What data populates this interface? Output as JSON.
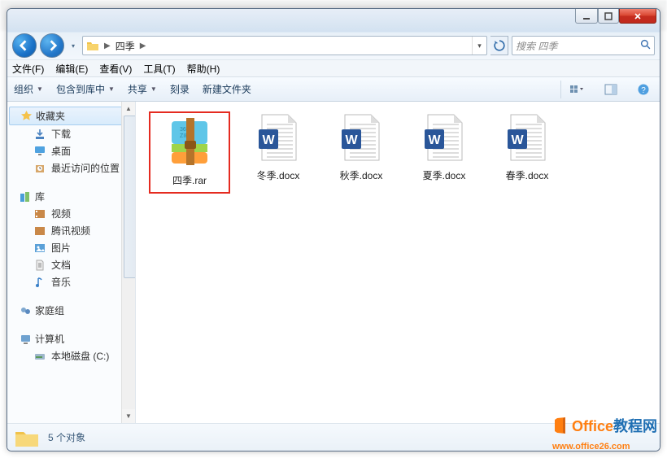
{
  "titlebar": {
    "min": "—",
    "max": "□",
    "close": "×"
  },
  "nav": {
    "path_label": "四季",
    "search_placeholder": "搜索 四季",
    "dropdown_glyph": "▾",
    "sep_glyph": "▶",
    "refresh_glyph": "↻"
  },
  "menubar": {
    "file": "文件(F)",
    "edit": "编辑(E)",
    "view": "查看(V)",
    "tools": "工具(T)",
    "help": "帮助(H)"
  },
  "toolbar": {
    "organize": "组织",
    "include": "包含到库中",
    "share": "共享",
    "burn": "刻录",
    "newfolder": "新建文件夹",
    "dd": "▼"
  },
  "sidebar": {
    "favorites": {
      "label": "收藏夹",
      "items": [
        "下载",
        "桌面",
        "最近访问的位置"
      ]
    },
    "libraries": {
      "label": "库",
      "items": [
        "视频",
        "腾讯视频",
        "图片",
        "文档",
        "音乐"
      ]
    },
    "homegroup": {
      "label": "家庭组"
    },
    "computer": {
      "label": "计算机",
      "items": [
        "本地磁盘 (C:)"
      ]
    }
  },
  "files": [
    {
      "name": "四季.rar",
      "type": "rar",
      "highlight": true
    },
    {
      "name": "冬季.docx",
      "type": "docx"
    },
    {
      "name": "秋季.docx",
      "type": "docx"
    },
    {
      "name": "夏季.docx",
      "type": "docx"
    },
    {
      "name": "春季.docx",
      "type": "docx"
    }
  ],
  "status": {
    "count": "5 个对象"
  },
  "watermark": {
    "line1_a": "Office",
    "line1_b": "教程网",
    "line2": "www.office26.com"
  }
}
